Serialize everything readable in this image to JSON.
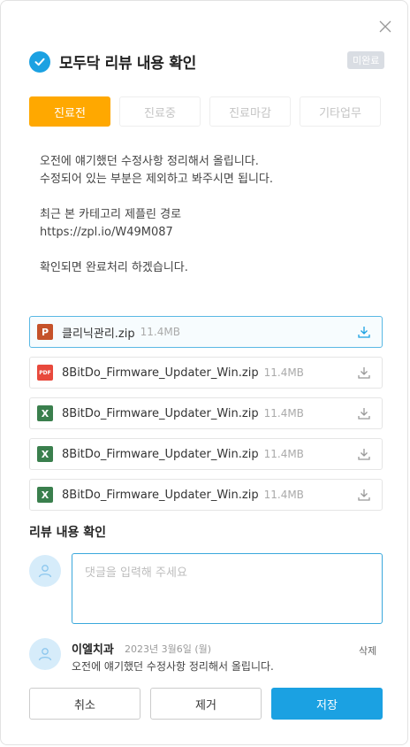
{
  "header": {
    "title": "모두닥 리뷰 내용 확인",
    "badge": "미완료"
  },
  "tabs": [
    {
      "label": "진료전",
      "active": true
    },
    {
      "label": "진료중",
      "active": false
    },
    {
      "label": "진료마감",
      "active": false
    },
    {
      "label": "기타업무",
      "active": false
    }
  ],
  "message": {
    "line1": "오전에 얘기했던 수정사항 정리해서 올립니다.",
    "line2": "수정되어 있는 부분은 제외하고 봐주시면 됩니다.",
    "line3": "최근 본 카테고리 제플린 경로",
    "line4": "https://zpl.io/W49M087",
    "line5": "확인되면 완료처리 하겠습니다."
  },
  "files": [
    {
      "type": "P",
      "name": "클리닉관리.zip",
      "size": "11.4MB"
    },
    {
      "type": "PDF",
      "name": "8BitDo_Firmware_Updater_Win.zip",
      "size": "11.4MB"
    },
    {
      "type": "X",
      "name": "8BitDo_Firmware_Updater_Win.zip",
      "size": "11.4MB"
    },
    {
      "type": "X",
      "name": "8BitDo_Firmware_Updater_Win.zip",
      "size": "11.4MB"
    },
    {
      "type": "X",
      "name": "8BitDo_Firmware_Updater_Win.zip",
      "size": "11.4MB"
    }
  ],
  "review": {
    "title": "리뷰 내용 확인",
    "placeholder": "댓글을 입력해 주세요",
    "comment": {
      "author": "이엘치과",
      "date": "2023년 3월6일 (월)",
      "delete_label": "삭제",
      "text": "오전에 얘기했던 수정사항 정리해서 올립니다."
    }
  },
  "buttons": {
    "cancel": "취소",
    "remove": "제거",
    "save": "저장"
  },
  "colors": {
    "accent": "#1ba1e2",
    "tab_active": "#ffa800"
  }
}
